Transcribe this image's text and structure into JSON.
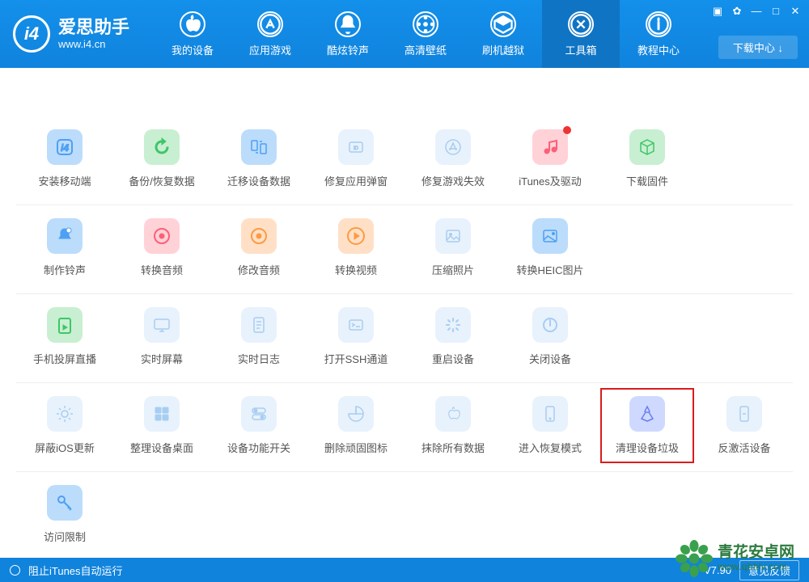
{
  "app": {
    "title": "爱思助手",
    "url": "www.i4.cn"
  },
  "titlebar": {
    "download_center": "下载中心 ↓"
  },
  "nav": [
    {
      "label": "我的设备",
      "icon": "apple"
    },
    {
      "label": "应用游戏",
      "icon": "app"
    },
    {
      "label": "酷炫铃声",
      "icon": "bell"
    },
    {
      "label": "高清壁纸",
      "icon": "wallpaper"
    },
    {
      "label": "刷机越狱",
      "icon": "jailbreak"
    },
    {
      "label": "工具箱",
      "icon": "tools",
      "active": true
    },
    {
      "label": "教程中心",
      "icon": "info"
    }
  ],
  "rows": [
    [
      {
        "label": "安装移动端",
        "color": "c-blue",
        "icon": "logo"
      },
      {
        "label": "备份/恢复数据",
        "color": "c-green",
        "icon": "restore"
      },
      {
        "label": "迁移设备数据",
        "color": "c-blue",
        "icon": "transfer"
      },
      {
        "label": "修复应用弹窗",
        "color": "c-faded",
        "icon": "appleid"
      },
      {
        "label": "修复游戏失效",
        "color": "c-faded",
        "icon": "appstore"
      },
      {
        "label": "iTunes及驱动",
        "color": "c-pink",
        "icon": "music",
        "dot": true
      },
      {
        "label": "下载固件",
        "color": "c-green",
        "icon": "cube"
      }
    ],
    [
      {
        "label": "制作铃声",
        "color": "c-blue",
        "icon": "bell2"
      },
      {
        "label": "转换音频",
        "color": "c-pink",
        "icon": "disc"
      },
      {
        "label": "修改音频",
        "color": "c-orange",
        "icon": "disc"
      },
      {
        "label": "转换视频",
        "color": "c-orange",
        "icon": "play"
      },
      {
        "label": "压缩照片",
        "color": "c-faded",
        "icon": "image"
      },
      {
        "label": "转换HEIC图片",
        "color": "c-blue",
        "icon": "heic"
      }
    ],
    [
      {
        "label": "手机投屏直播",
        "color": "c-green",
        "icon": "cast"
      },
      {
        "label": "实时屏幕",
        "color": "c-faded",
        "icon": "monitor"
      },
      {
        "label": "实时日志",
        "color": "c-faded",
        "icon": "doc"
      },
      {
        "label": "打开SSH通道",
        "color": "c-faded",
        "icon": "ssh"
      },
      {
        "label": "重启设备",
        "color": "c-faded",
        "icon": "loading"
      },
      {
        "label": "关闭设备",
        "color": "c-faded",
        "icon": "power"
      }
    ],
    [
      {
        "label": "屏蔽iOS更新",
        "color": "c-faded",
        "icon": "gear"
      },
      {
        "label": "整理设备桌面",
        "color": "c-faded",
        "icon": "grid"
      },
      {
        "label": "设备功能开关",
        "color": "c-faded",
        "icon": "toggles"
      },
      {
        "label": "删除顽固图标",
        "color": "c-faded",
        "icon": "pie"
      },
      {
        "label": "抹除所有数据",
        "color": "c-faded",
        "icon": "apple2"
      },
      {
        "label": "进入恢复模式",
        "color": "c-faded",
        "icon": "phone"
      },
      {
        "label": "清理设备垃圾",
        "color": "c-blue2",
        "icon": "clean",
        "highlight": true
      },
      {
        "label": "反激活设备",
        "color": "c-faded",
        "icon": "phone2"
      }
    ],
    [
      {
        "label": "访问限制",
        "color": "c-blue",
        "icon": "key"
      }
    ]
  ],
  "footer": {
    "itunes": "阻止iTunes自动运行",
    "version": "V7.90",
    "feedback": "意见反馈"
  },
  "watermark": {
    "cn": "青花安卓网",
    "en": "www.qhhlv.com"
  }
}
